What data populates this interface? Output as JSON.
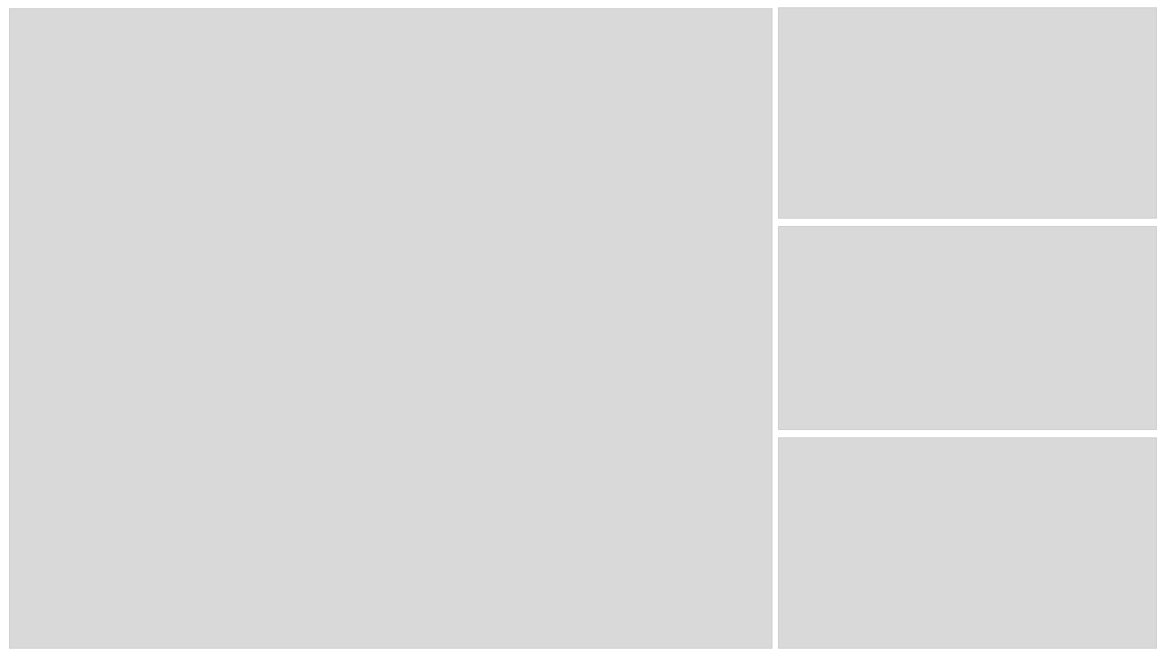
{
  "layout": {
    "main_panel": {
      "label": ""
    },
    "side_panels": [
      {
        "label": ""
      },
      {
        "label": ""
      },
      {
        "label": ""
      }
    ]
  },
  "colors": {
    "background": "#ffffff",
    "panel_fill": "#d9d9d9"
  }
}
